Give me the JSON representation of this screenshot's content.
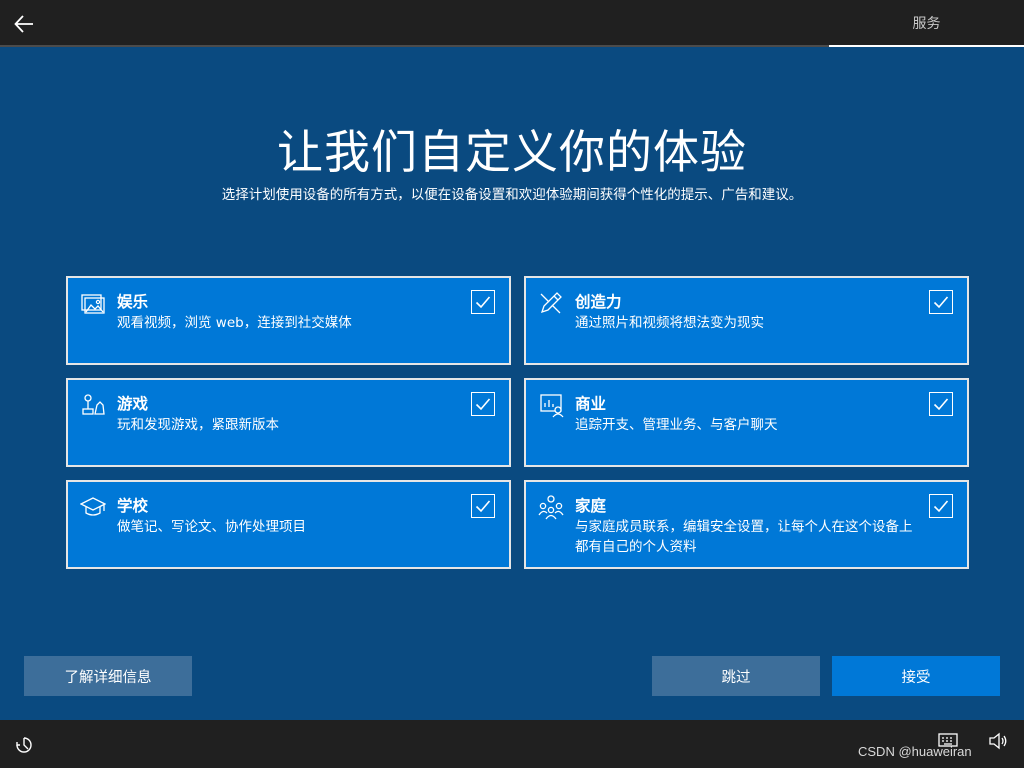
{
  "header": {
    "tab_label": "服务"
  },
  "main": {
    "title": "让我们自定义你的体验",
    "subtitle": "选择计划使用设备的所有方式，以便在设备设置和欢迎体验期间获得个性化的提示、广告和建议。"
  },
  "cards": [
    {
      "title": "娱乐",
      "desc": "观看视频，浏览 web，连接到社交媒体",
      "icon": "picture-icon",
      "checked": true
    },
    {
      "title": "创造力",
      "desc": "通过照片和视频将想法变为现实",
      "icon": "pen-icon",
      "checked": true
    },
    {
      "title": "游戏",
      "desc": "玩和发现游戏，紧跟新版本",
      "icon": "game-icon",
      "checked": true
    },
    {
      "title": "商业",
      "desc": "追踪开支、管理业务、与客户聊天",
      "icon": "business-icon",
      "checked": true
    },
    {
      "title": "学校",
      "desc": "做笔记、写论文、协作处理项目",
      "icon": "graduation-cap-icon",
      "checked": true
    },
    {
      "title": "家庭",
      "desc": "与家庭成员联系，编辑安全设置，让每个人在这个设备上都有自己的个人资料",
      "icon": "family-icon",
      "checked": true
    }
  ],
  "buttons": {
    "learn_more": "了解详细信息",
    "skip": "跳过",
    "accept": "接受"
  },
  "footer": {
    "watermark": "CSDN @huaweiran"
  },
  "colors": {
    "background": "#0a4a80",
    "card": "#0078d7",
    "topbar": "#202020",
    "secondary_button": "#3d6e9a"
  }
}
